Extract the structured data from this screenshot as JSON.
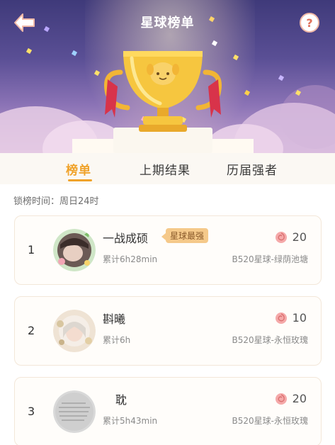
{
  "header": {
    "title": "星球榜单"
  },
  "tabs": [
    {
      "label": "榜单"
    },
    {
      "label": "上期结果"
    },
    {
      "label": "历届强者"
    }
  ],
  "lock_time": "锁榜时间：周日24时",
  "entries": [
    {
      "rank": "1",
      "name": "一战成硕",
      "badge": "星球最强",
      "total": "累计6h28min",
      "planet": "B520星球-绿荫池塘",
      "score": "20"
    },
    {
      "rank": "2",
      "name": "斟曦",
      "badge": "",
      "total": "累计6h",
      "planet": "B520星球-永恒玫瑰",
      "score": "10"
    },
    {
      "rank": "3",
      "name": "耽",
      "badge": "",
      "total": "累计5h43min",
      "planet": "B520星球-永恒玫瑰",
      "score": "20"
    }
  ],
  "colors": {
    "accent": "#f0a229",
    "banner_top": "#3f3a7a",
    "badge_bg": "#f5c98a",
    "rose": "#f19a9a"
  },
  "icons": {
    "back": "back-arrow-icon",
    "help": "question-icon",
    "score": "rose-icon"
  }
}
